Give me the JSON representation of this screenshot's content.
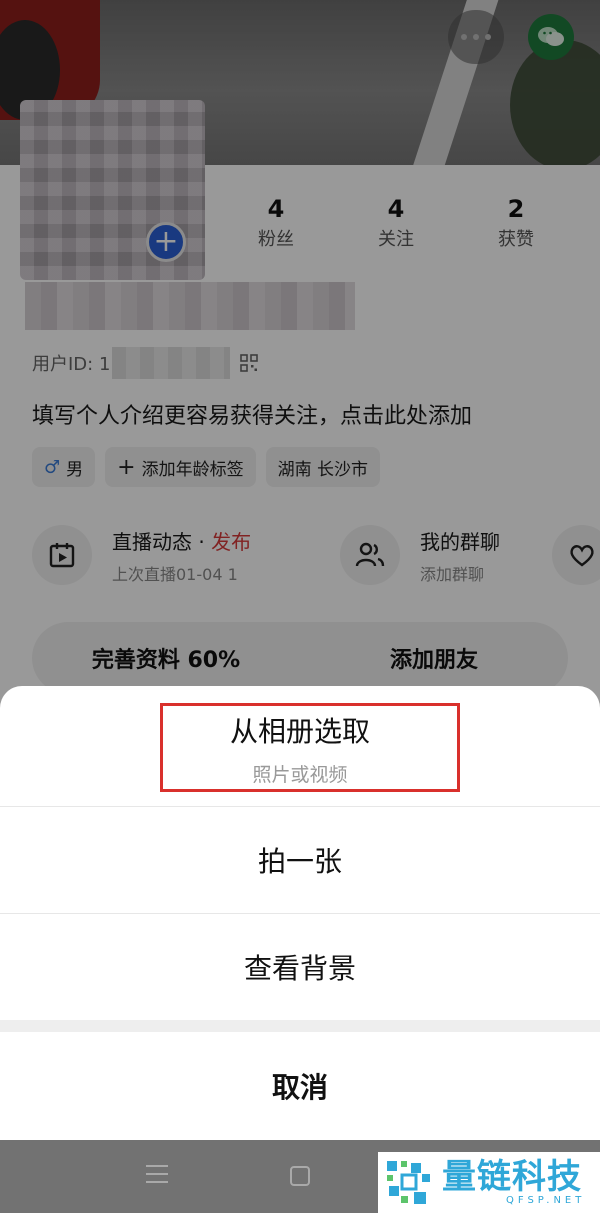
{
  "header": {
    "more_icon": "more-dots-icon",
    "wechat_icon": "wechat-icon"
  },
  "profile": {
    "stats": [
      {
        "value": "4",
        "label": "粉丝"
      },
      {
        "value": "4",
        "label": "关注"
      },
      {
        "value": "2",
        "label": "获赞"
      }
    ],
    "user_id_label": "用户ID: 1",
    "bio": "填写个人介绍更容易获得关注，点击此处添加",
    "tags": {
      "gender": "男",
      "age": "添加年龄标签",
      "location": "湖南 长沙市"
    },
    "features": {
      "live_title": "直播动态 · ",
      "live_accent": "发布",
      "live_sub": "上次直播01-04 1",
      "group_title": "我的群聊",
      "group_sub": "添加群聊"
    },
    "actions": {
      "complete": "完善资料 60%",
      "add_friend": "添加朋友"
    }
  },
  "sheet": {
    "album_title": "从相册选取",
    "album_sub": "照片或视频",
    "take_photo": "拍一张",
    "view_background": "查看背景",
    "cancel": "取消"
  },
  "watermark": {
    "name": "量链科技",
    "domain": "QFSP.NET"
  },
  "colors": {
    "highlight_border": "#d9302c",
    "accent_red": "#d73a3a",
    "avatar_add_blue": "#2b5fd6",
    "watermark_blue": "#2fa7d8"
  }
}
